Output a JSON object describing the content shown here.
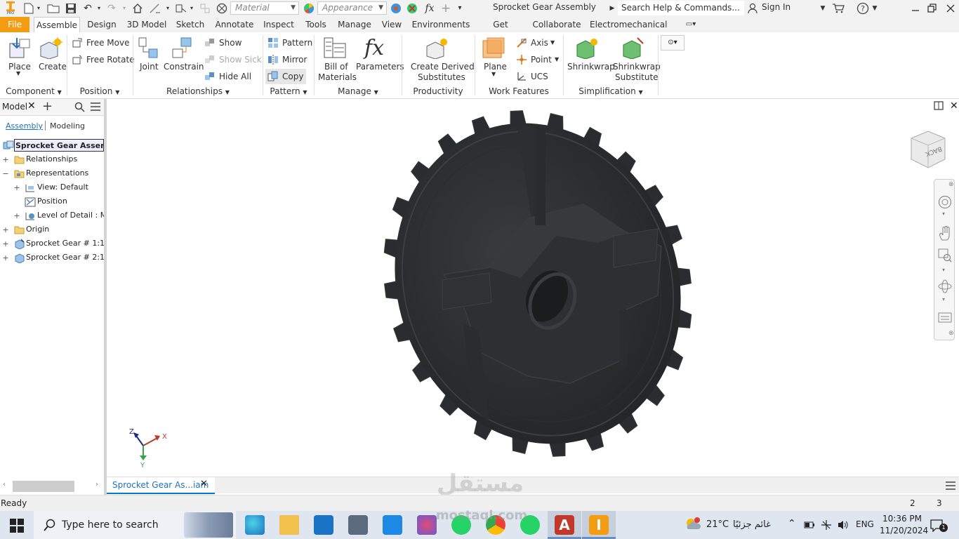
{
  "qat": {
    "material": "Material",
    "appearance": "Appearance",
    "title": "Sprocket Gear Assembly",
    "search_placeholder": "Search Help & Commands...",
    "sign_in": "Sign In",
    "fx": "fx"
  },
  "menu": {
    "tabs": [
      "File",
      "Assemble",
      "Design",
      "3D Model",
      "Sketch",
      "Annotate",
      "Inspect",
      "Tools",
      "Manage",
      "View",
      "Environments",
      "Get Started",
      "Collaborate",
      "Electromechanical"
    ]
  },
  "ribbon": {
    "place": "Place",
    "create": "Create",
    "free_move": "Free Move",
    "free_rotate": "Free Rotate",
    "joint": "Joint",
    "constrain": "Constrain",
    "show": "Show",
    "show_sick": "Show Sick",
    "hide_all": "Hide All",
    "pattern": "Pattern",
    "mirror": "Mirror",
    "copy": "Copy",
    "bom_1": "Bill of",
    "bom_2": "Materials",
    "parameters": "Parameters",
    "derived_1": "Create Derived",
    "derived_2": "Substitutes",
    "plane": "Plane",
    "axis": "Axis",
    "point": "Point",
    "ucs": "UCS",
    "shrinkwrap": "Shrinkwrap",
    "sw_sub_1": "Shrinkwrap",
    "sw_sub_2": "Substitute",
    "groups": {
      "component": "Component",
      "position": "Position",
      "relationships": "Relationships",
      "pattern": "Pattern",
      "manage": "Manage",
      "productivity": "Productivity",
      "work_features": "Work Features",
      "simplification": "Simplification"
    }
  },
  "browser": {
    "title": "Model",
    "tab_assembly": "Assembly",
    "tab_modeling": "Modeling",
    "root": "Sprocket Gear Assembly",
    "items": {
      "relationships": "Relationships",
      "representations": "Representations",
      "view": "View: Default",
      "position": "Position",
      "lod": "Level of Detail : Master",
      "origin": "Origin",
      "gear1": "Sprocket Gear # 1:1",
      "gear2": "Sprocket Gear # 2:1"
    }
  },
  "viewcube": {
    "label": "BACK"
  },
  "triad": {
    "x": "X",
    "y": "Y",
    "z": "Z"
  },
  "doc_tab": "Sprocket Gear As...iam",
  "status": {
    "text": "Ready",
    "n1": "2",
    "n2": "3"
  },
  "taskbar": {
    "search": "Type here to search",
    "weather": "21°C",
    "weather_text": "غائم جزئيًا",
    "lang": "ENG",
    "time": "10:36 PM",
    "date": "11/20/2024",
    "notif": "1"
  },
  "watermark": {
    "line1": "مستقل",
    "line2": "mostaql.com"
  },
  "colors": {
    "accent": "#f39c12",
    "select": "#0078d7",
    "gear": "#2a2b2d"
  }
}
